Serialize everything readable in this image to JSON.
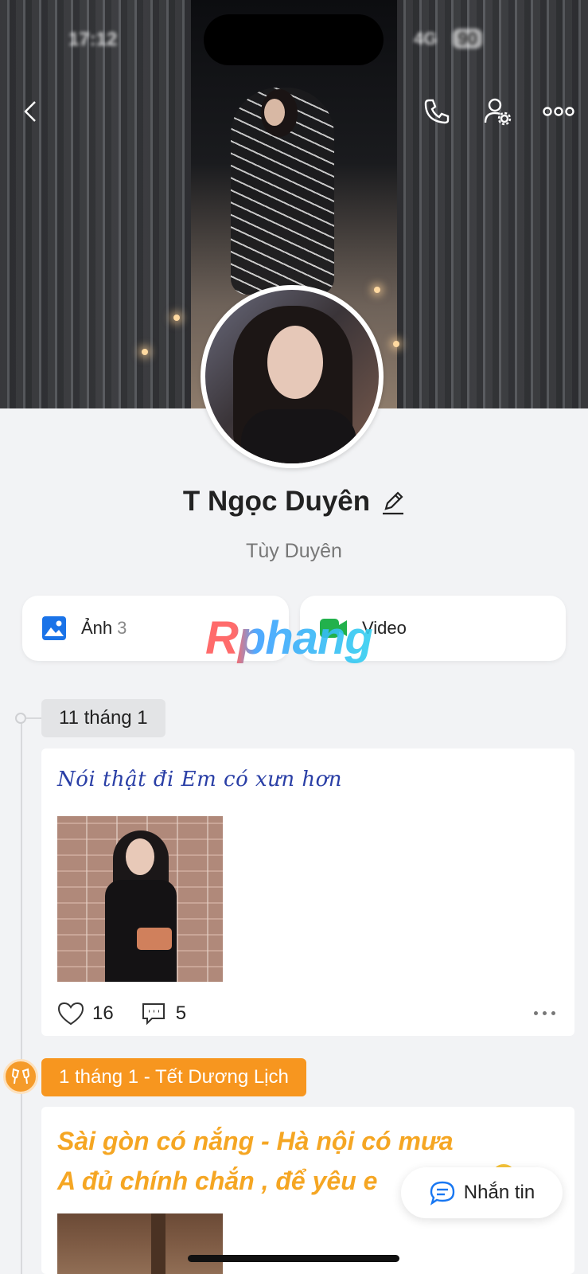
{
  "status_bar": {
    "time": "17:12",
    "network": "4G",
    "battery": "90"
  },
  "profile": {
    "name": "T Ngọc Duyên",
    "alias": "Tùy Duyên"
  },
  "media": {
    "photos_label": "Ảnh",
    "photos_count": "3",
    "video_label": "Video"
  },
  "watermark": "Rphang",
  "timeline": [
    {
      "date": "11 tháng 1",
      "text": "Nói thật đi Em có xưn hơn",
      "likes": "16",
      "comments": "5"
    },
    {
      "date": "1 tháng 1 - Tết Dương Lịch",
      "text_line1": "Sài gòn có nắng - Hà nội có mưa",
      "text_line2": "A đủ chính chắn , để yêu e"
    }
  ],
  "chat_button": "Nhắn tin",
  "colors": {
    "accent": "#1877f2",
    "holiday": "#f7961f",
    "post_blue": "#2a3fa6",
    "post_orange": "#f5a623"
  }
}
